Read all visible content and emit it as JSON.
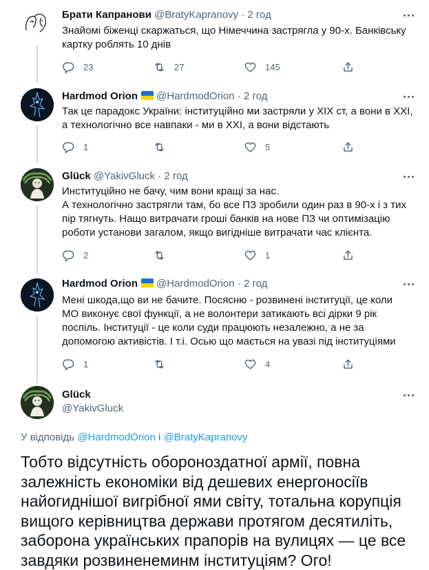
{
  "tweets": [
    {
      "name": "Брати Капранови",
      "handle": "@BratyKapranovy",
      "time": "2 год",
      "flag": false,
      "text": "Знайомі біженці скаржаться, що Німеччина застрягла у 90-х. Банківську картку роблять 10 днів",
      "replies": "23",
      "retweets": "27",
      "likes": "145"
    },
    {
      "name": "Hardmod Orion",
      "handle": "@HardmodOrion",
      "time": "2 год",
      "flag": true,
      "text": "Так це парадокс України: інституційно ми застряли у XIX ст, а вони в XXI, а технологічно все навпаки - ми в XXI, а вони відстають",
      "replies": "1",
      "retweets": "",
      "likes": "5"
    },
    {
      "name": "Glück",
      "handle": "@YakivGluck",
      "time": "2 год",
      "flag": false,
      "text": "Институційно не бачу, чим вони кращі за нас.\nА технологічно застрягли там, бо все ПЗ зробили один раз в 90-х і з тих пір тягнуть. Нащо витрачати гроші банків на нове ПЗ чи оптимізацію роботи установи загалом, якщо вигідніше витрачати час клієнта.",
      "replies": "2",
      "retweets": "",
      "likes": "1"
    },
    {
      "name": "Hardmod Orion",
      "handle": "@HardmodOrion",
      "time": "2 год",
      "flag": true,
      "text": "Мені шкода,що ви не бачите. Посясню - розвинені інституції, це коли МО виконує свої функції, а не волонтери затикають всі дірки 9 рік поспіль. Інституції - це коли суди працюють незалежно, а не за допомогою активістів. І т.і. Осью що мається на увазі під інституціями",
      "replies": "1",
      "retweets": "",
      "likes": "4"
    }
  ],
  "main_tweet": {
    "name": "Glück",
    "handle": "@YakivGluck",
    "reply_prefix": "У відповідь",
    "reply_mention_1": "@HardmodOrion",
    "reply_joiner": "і",
    "reply_mention_2": "@BratyKapranovy",
    "text": "Тобто відсутність обороноздатної армії, повна залежність економіки від дешевих енергоносіїв найогиднішої вигрібної ями світу, тотальна корупція вищого керівництва держави протягом десятиліть, заборона українських прапорів на вулицях — це все завдяки розвиненеминм інституціям? Ого!"
  },
  "separator": "·",
  "icons": {
    "reply": "reply-icon",
    "retweet": "retweet-icon",
    "like": "heart-icon",
    "share": "share-icon",
    "more": "more-icon"
  },
  "colors": {
    "text": "#0f1419",
    "secondary": "#536471",
    "link": "#1d9bf0",
    "line": "#cfd9de",
    "flag_blue": "#1d6fd1",
    "flag_yellow": "#ffd500"
  }
}
